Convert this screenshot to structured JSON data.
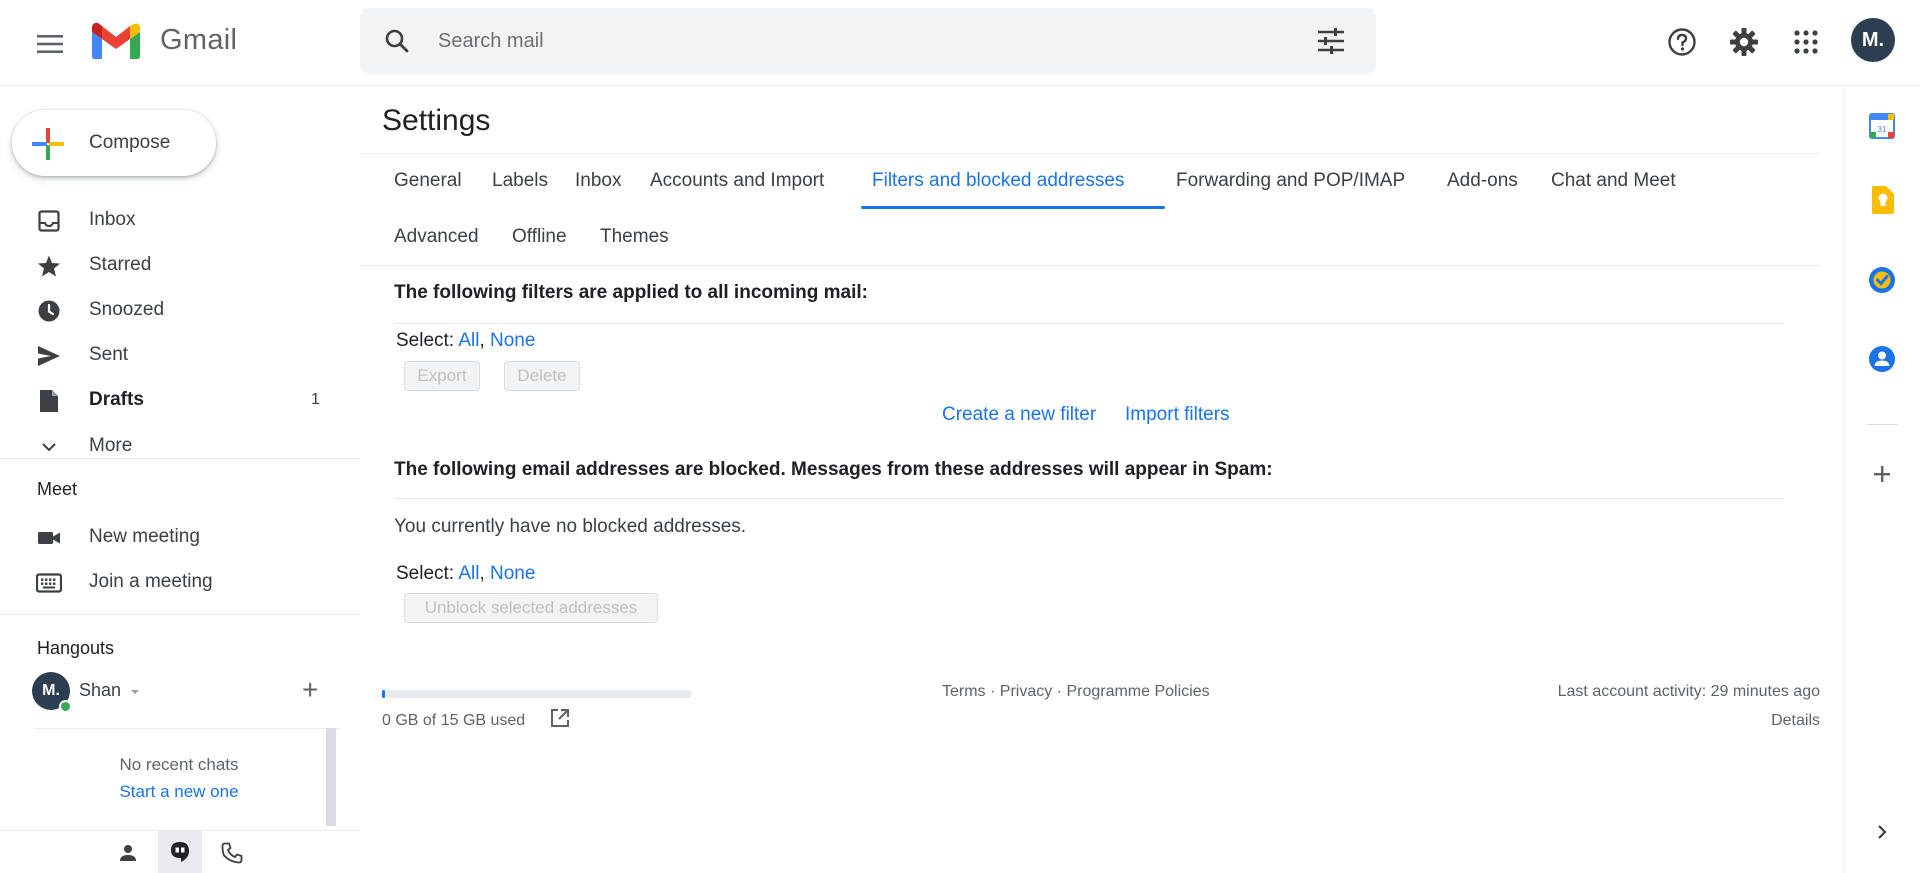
{
  "header": {
    "app_name": "Gmail",
    "search_placeholder": "Search mail",
    "avatar_initials": "M."
  },
  "sidebar": {
    "compose_label": "Compose",
    "items": [
      {
        "label": "Inbox",
        "icon": "inbox-icon",
        "count": ""
      },
      {
        "label": "Starred",
        "icon": "star-icon",
        "count": ""
      },
      {
        "label": "Snoozed",
        "icon": "clock-icon",
        "count": ""
      },
      {
        "label": "Sent",
        "icon": "send-icon",
        "count": ""
      },
      {
        "label": "Drafts",
        "icon": "draft-icon",
        "count": "1"
      },
      {
        "label": "More",
        "icon": "chevron-down-icon",
        "count": ""
      }
    ],
    "meet": {
      "title": "Meet",
      "new_meeting": "New meeting",
      "join_meeting": "Join a meeting"
    },
    "hangouts": {
      "title": "Hangouts",
      "user_initials": "M.",
      "user_name": "Shan",
      "no_chats": "No recent chats",
      "start_new": "Start a new one"
    }
  },
  "settings": {
    "title": "Settings",
    "tabs": [
      "General",
      "Labels",
      "Inbox",
      "Accounts and Import",
      "Filters and blocked addresses",
      "Forwarding and POP/IMAP",
      "Add-ons",
      "Chat and Meet",
      "Advanced",
      "Offline",
      "Themes"
    ],
    "active_tab": "Filters and blocked addresses",
    "filters": {
      "heading": "The following filters are applied to all incoming mail:",
      "select_label": "Select:",
      "select_all": "All",
      "select_sep": ",",
      "select_none": "None",
      "export_button": "Export",
      "delete_button": "Delete",
      "create_filter": "Create a new filter",
      "import_filters": "Import filters"
    },
    "blocked": {
      "heading": "The following email addresses are blocked. Messages from these addresses will appear in Spam:",
      "empty_text": "You currently have no blocked addresses.",
      "select_label": "Select:",
      "select_all": "All",
      "select_sep": ",",
      "select_none": "None",
      "unblock_button": "Unblock selected addresses"
    },
    "footer": {
      "storage": "0 GB of 15 GB used",
      "storage_fraction": 0.0,
      "terms": "Terms",
      "privacy": "Privacy",
      "policies": "Programme Policies",
      "separator": " · ",
      "last_activity": "Last account activity: 29 minutes ago",
      "details": "Details"
    }
  },
  "colors": {
    "accent": "#1a73e8",
    "avatar": "#2c3e50",
    "online": "#34a853"
  }
}
